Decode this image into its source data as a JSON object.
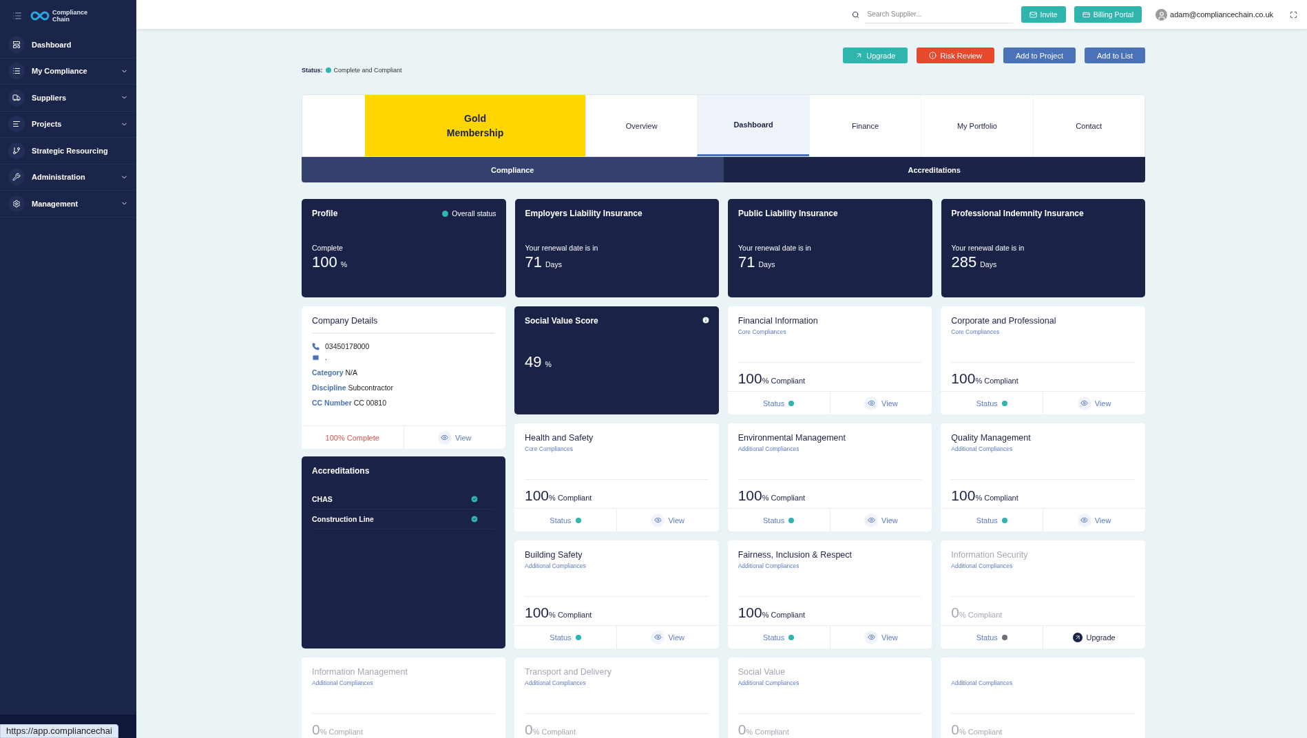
{
  "sidebar": {
    "logo_lines": [
      "Compliance",
      "Chain"
    ],
    "items": [
      {
        "label": "Dashboard",
        "expandable": false
      },
      {
        "label": "My Compliance",
        "expandable": true
      },
      {
        "label": "Suppliers",
        "expandable": true
      },
      {
        "label": "Projects",
        "expandable": true
      },
      {
        "label": "Strategic Resourcing",
        "expandable": false
      },
      {
        "label": "Administration",
        "expandable": true
      },
      {
        "label": "Management",
        "expandable": true
      }
    ]
  },
  "topbar": {
    "search": {
      "placeholder": "Search Supplier..."
    },
    "buttons": [
      {
        "label": "Invite",
        "kind": "mail"
      },
      {
        "label": "Billing Portal",
        "kind": "card"
      }
    ],
    "user": "adam@compliancechain.co.uk"
  },
  "actions": [
    {
      "label": "Upgrade",
      "kind": "upgrade"
    },
    {
      "label": "Risk Review",
      "kind": "risk"
    },
    {
      "label": "Add to Project",
      "kind": "plain"
    },
    {
      "label": "Add to List",
      "kind": "plain"
    }
  ],
  "status": {
    "label": "Status:",
    "text": "Complete and Compliant",
    "color": "#2fb5ad"
  },
  "membership": "Gold Membership",
  "nav_tabs": [
    {
      "label": "Overview",
      "selected": false
    },
    {
      "label": "Dashboard",
      "selected": true
    },
    {
      "label": "Finance",
      "selected": false
    },
    {
      "label": "My Portfolio",
      "selected": false
    },
    {
      "label": "Contact",
      "selected": false
    }
  ],
  "sub_tabs": [
    {
      "label": "Compliance",
      "selected": true
    },
    {
      "label": "Accreditations",
      "selected": false
    }
  ],
  "summary_cards": [
    {
      "kind": "profile",
      "title": "Profile",
      "badge": "Overall status",
      "caption": "Complete",
      "value": "100",
      "unit": "%"
    },
    {
      "kind": "insurance",
      "title": "Employers Liability Insurance",
      "caption": "Your renewal date is in",
      "value": "71",
      "unit": "Days"
    },
    {
      "kind": "insurance",
      "title": "Public Liability Insurance",
      "caption": "Your renewal date is in",
      "value": "71",
      "unit": "Days"
    },
    {
      "kind": "insurance",
      "title": "Professional Indemnity Insurance",
      "caption": "Your renewal date is in",
      "value": "285",
      "unit": "Days"
    }
  ],
  "company": {
    "title": "Company Details",
    "phone": "03450178000",
    "email": ".",
    "fields": [
      {
        "label": "Category",
        "value": "N/A"
      },
      {
        "label": "Discipline",
        "value": "Subcontractor"
      },
      {
        "label": "CC Number",
        "value": "CC 00810"
      }
    ],
    "complete": "100% Complete",
    "action": "View"
  },
  "accreditations": {
    "title": "Accreditations",
    "items": [
      {
        "name": "CHAS",
        "verified": true
      },
      {
        "name": "Construction Line",
        "verified": true
      }
    ]
  },
  "social_value": {
    "title": "Social Value Score",
    "value": "49",
    "unit": "%"
  },
  "left_card": {
    "title": "Information Management",
    "subtitle": "Additional Compliances",
    "value": "0",
    "unit": "% Compliant",
    "enabled": false
  },
  "compliance_cards": [
    {
      "title": "Financial Information",
      "subtitle": "Core Compliances",
      "value": "100",
      "unit": "% Compliant",
      "enabled": true,
      "footer": {
        "status": "Status",
        "color": "#2fb5ad",
        "action": {
          "kind": "view",
          "label": "View"
        }
      }
    },
    {
      "title": "Corporate and Professional",
      "subtitle": "Core Compliances",
      "value": "100",
      "unit": "% Compliant",
      "enabled": true,
      "footer": {
        "status": "Status",
        "color": "#2fb5ad",
        "action": {
          "kind": "view",
          "label": "View"
        }
      }
    },
    {
      "title": "Health and Safety",
      "subtitle": "Core Compliances",
      "value": "100",
      "unit": "% Compliant",
      "enabled": true,
      "footer": {
        "status": "Status",
        "color": "#2fb5ad",
        "action": {
          "kind": "view",
          "label": "View"
        }
      }
    },
    {
      "title": "Environmental Management",
      "subtitle": "Additional Compliances",
      "value": "100",
      "unit": "% Compliant",
      "enabled": true,
      "footer": {
        "status": "Status",
        "color": "#2fb5ad",
        "action": {
          "kind": "view",
          "label": "View"
        }
      }
    },
    {
      "title": "Quality Management",
      "subtitle": "Additional Compliances",
      "value": "100",
      "unit": "% Compliant",
      "enabled": true,
      "footer": {
        "status": "Status",
        "color": "#2fb5ad",
        "action": {
          "kind": "view",
          "label": "View"
        }
      }
    },
    {
      "title": "Building Safety",
      "subtitle": "Additional Compliances",
      "value": "100",
      "unit": "% Compliant",
      "enabled": true,
      "footer": {
        "status": "Status",
        "color": "#2fb5ad",
        "action": {
          "kind": "view",
          "label": "View"
        }
      }
    },
    {
      "title": "Fairness, Inclusion & Respect",
      "subtitle": "Additional Compliances",
      "value": "100",
      "unit": "% Compliant",
      "enabled": true,
      "footer": {
        "status": "Status",
        "color": "#2fb5ad",
        "action": {
          "kind": "view",
          "label": "View"
        }
      }
    },
    {
      "title": "Information Security",
      "subtitle": "Additional Compliances",
      "value": "0",
      "unit": "% Compliant",
      "enabled": false,
      "footer": {
        "status": "Status",
        "color": "#6b6f7a",
        "action": {
          "kind": "upgrade",
          "label": "Upgrade"
        }
      }
    },
    {
      "title": "Transport and Delivery",
      "subtitle": "Additional Compliances",
      "value": "0",
      "unit": "% Compliant",
      "enabled": false
    },
    {
      "title": "Social Value",
      "subtitle": "Additional Compliances",
      "value": "0",
      "unit": "% Compliant",
      "enabled": false
    },
    {
      "subtitle": "Additional Compliances",
      "value": "0",
      "unit": "% Compliant",
      "enabled": false
    }
  ],
  "url_tooltip": "https://app.compliancechai"
}
